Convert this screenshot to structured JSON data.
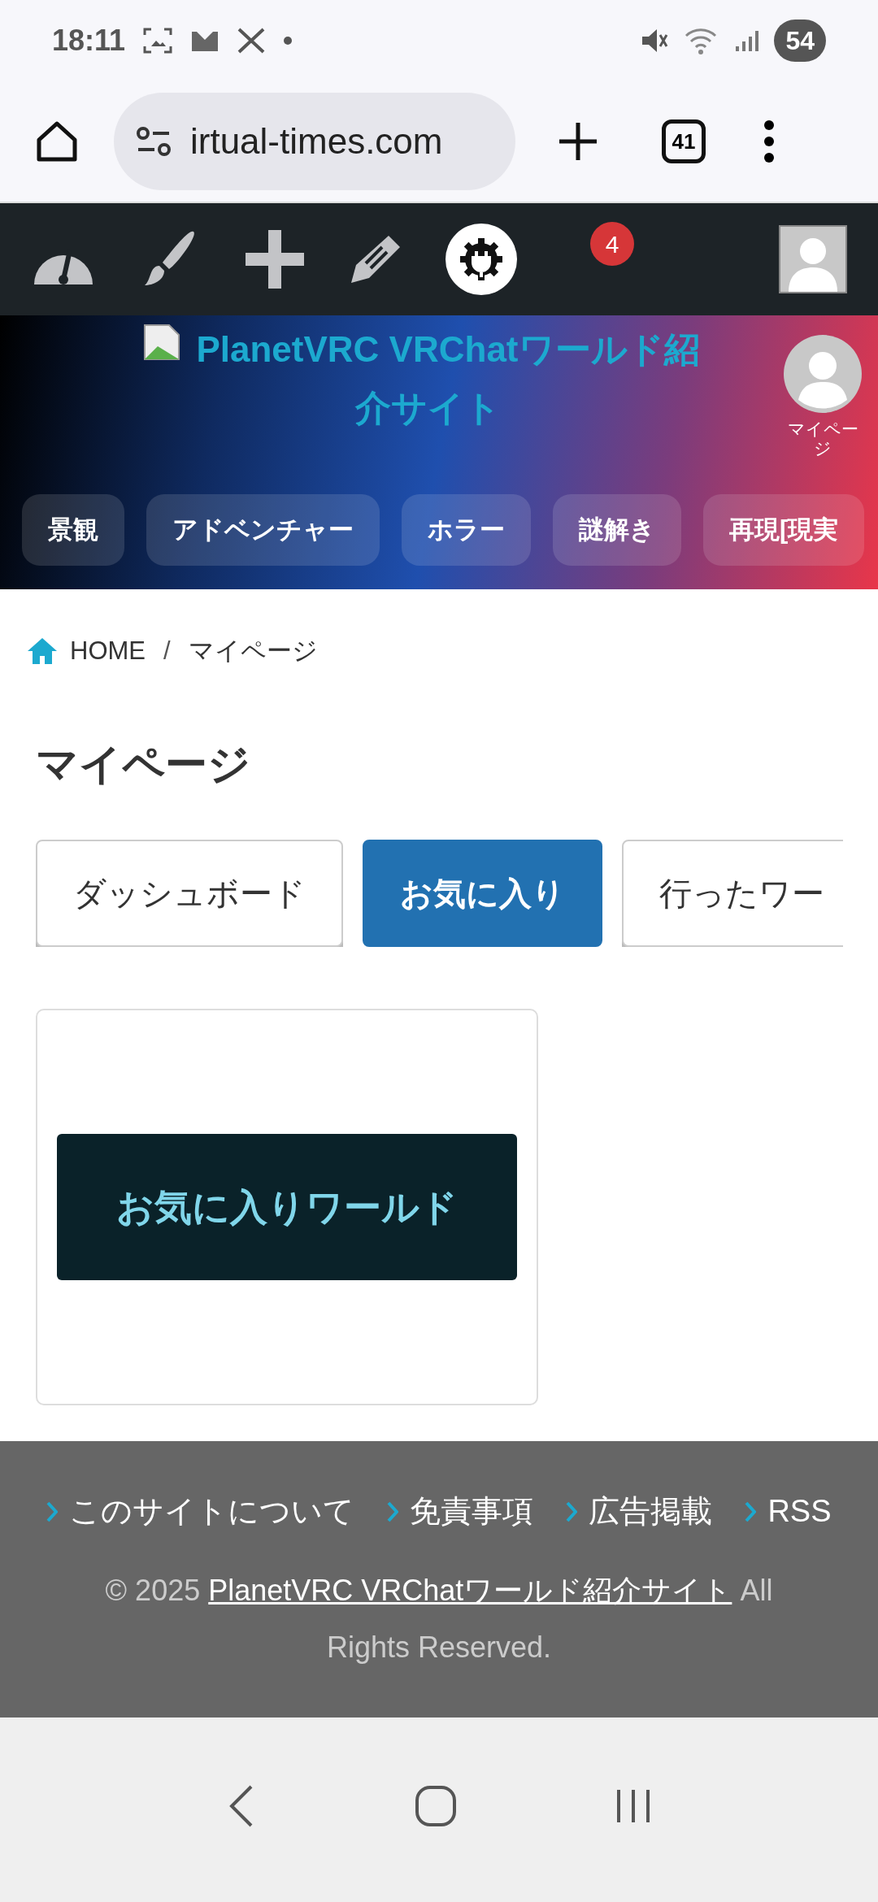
{
  "status_bar": {
    "time": "18:11",
    "battery": "54"
  },
  "browser": {
    "url": "irtual-times.com",
    "tab_count": "41"
  },
  "admin_bar": {
    "notification_count": "4"
  },
  "header": {
    "site_title": "PlanetVRC VRChatワールド紹介サイト",
    "mypage_label": "マイページ",
    "categories": [
      "景観",
      "アドベンチャー",
      "ホラー",
      "謎解き",
      "再現[現実"
    ]
  },
  "breadcrumb": [
    "HOME",
    "/",
    "マイページ"
  ],
  "page_title": "マイページ",
  "tabs": [
    {
      "label": "ダッシュボード",
      "selected": false
    },
    {
      "label": "お気に入り",
      "selected": true
    },
    {
      "label": "行ったワー",
      "selected": false
    }
  ],
  "favorites_card": {
    "button": "お気に入りワールド"
  },
  "footer": {
    "links": [
      "このサイトについて",
      "免責事項",
      "広告掲載",
      "RSS"
    ],
    "copyright_prefix": "© 2025",
    "copyright_link": "PlanetVRC VRChatワールド紹介サイト",
    "copyright_suffix": "All Rights Reserved."
  }
}
